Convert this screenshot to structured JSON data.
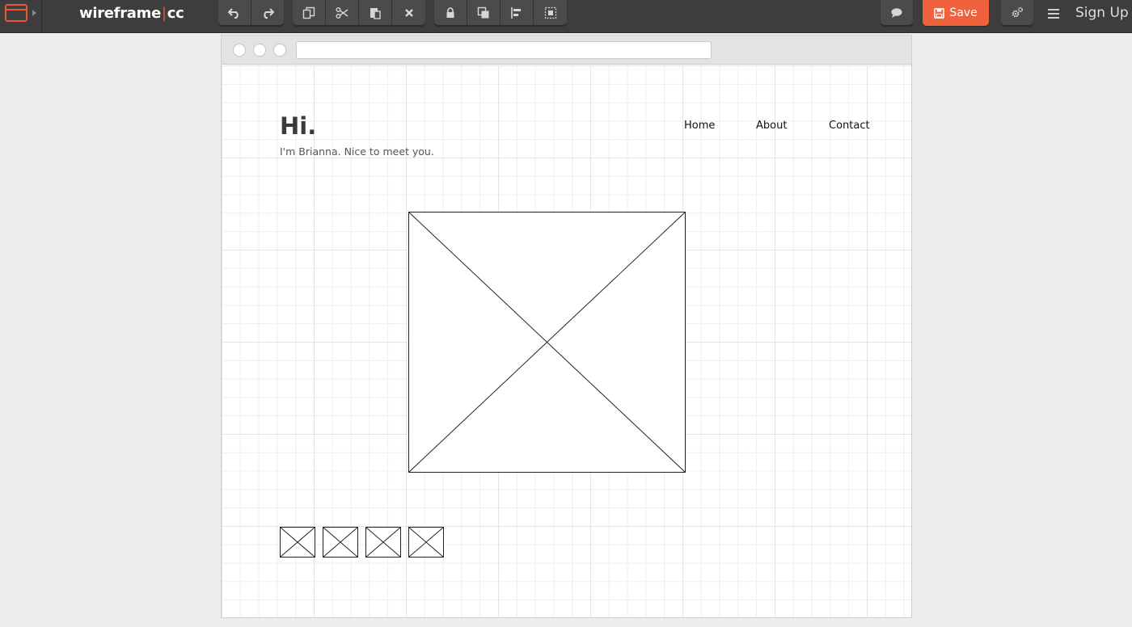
{
  "app": {
    "brand_left": "wireframe",
    "brand_sep": "|",
    "brand_right": "cc",
    "accent_color": "#e8553a"
  },
  "toolbar": {
    "history": [
      {
        "name": "undo-button",
        "icon": "undo-icon"
      },
      {
        "name": "redo-button",
        "icon": "redo-icon"
      }
    ],
    "edit": [
      {
        "name": "copy-button",
        "icon": "copy-icon"
      },
      {
        "name": "cut-button",
        "icon": "scissors-icon"
      },
      {
        "name": "paste-button",
        "icon": "paste-icon"
      },
      {
        "name": "delete-button",
        "icon": "close-icon"
      }
    ],
    "arrange": [
      {
        "name": "lock-button",
        "icon": "lock-icon"
      },
      {
        "name": "bring-front-button",
        "icon": "layers-icon"
      },
      {
        "name": "align-button",
        "icon": "align-left-icon"
      },
      {
        "name": "group-button",
        "icon": "group-select-icon"
      }
    ],
    "save_label": "Save",
    "save_color": "#f0613e",
    "signup_label": "Sign Up"
  },
  "wireframe": {
    "heading": "Hi.",
    "subtitle": "I'm Brianna. Nice to meet you.",
    "nav": {
      "home": "Home",
      "about": "About",
      "contact": "Contact"
    },
    "thumbnail_count": 4
  }
}
